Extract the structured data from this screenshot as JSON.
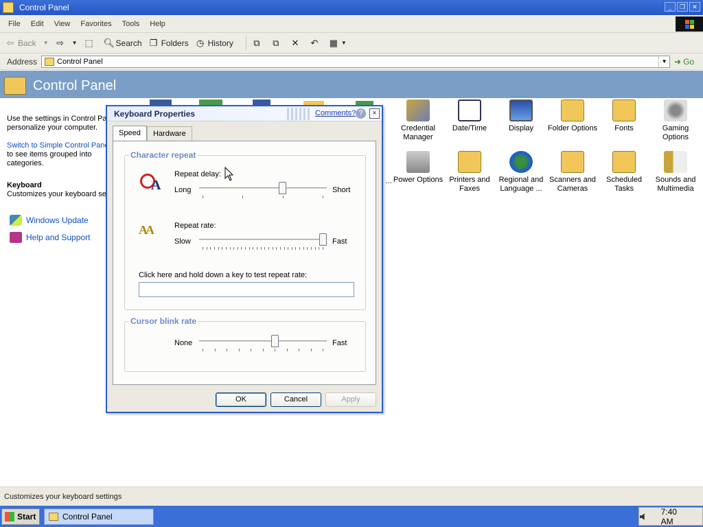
{
  "window": {
    "title": "Control Panel"
  },
  "menu": [
    "File",
    "Edit",
    "View",
    "Favorites",
    "Tools",
    "Help"
  ],
  "toolbar": {
    "back": "Back",
    "search": "Search",
    "folders": "Folders",
    "history": "History"
  },
  "address": {
    "label": "Address",
    "value": "Control Panel",
    "go": "Go"
  },
  "header": {
    "title": "Control Panel"
  },
  "sidebar": {
    "intro": [
      "Use the settings in Control Pan",
      "personalize your computer."
    ],
    "switch_link": "Switch to Simple Control Panel",
    "switch_desc": [
      "to see items grouped into",
      "categories."
    ],
    "selected_title": "Keyboard",
    "selected_desc": "Customizes your keyboard set",
    "links": [
      "Windows Update",
      "Help and Support"
    ]
  },
  "icons": [
    {
      "label": "Credential Manager"
    },
    {
      "label": "Date/Time"
    },
    {
      "label": "Display"
    },
    {
      "label": "Folder Options"
    },
    {
      "label": "Fonts"
    },
    {
      "label": "Gaming Options"
    },
    {
      "label": "Power Options"
    },
    {
      "label": "Printers and Faxes"
    },
    {
      "label": "Regional and Language ..."
    },
    {
      "label": "Scanners and Cameras"
    },
    {
      "label": "Scheduled Tasks"
    },
    {
      "label": "Sounds and Multimedia"
    }
  ],
  "partial_icon_label": "l ...",
  "dialog": {
    "title": "Keyboard Properties",
    "comments": "Comments?",
    "help": "?",
    "close": "×",
    "tabs": [
      "Speed",
      "Hardware"
    ],
    "char_repeat": {
      "title": "Character repeat",
      "delay_label": "Repeat delay:",
      "delay_min": "Long",
      "delay_max": "Short",
      "delay_value": 0.66,
      "rate_label": "Repeat rate:",
      "rate_min": "Slow",
      "rate_max": "Fast",
      "rate_value": 1.0,
      "test_label": "Click here and hold down a key to test repeat rate:"
    },
    "cursor": {
      "title": "Cursor blink rate",
      "min": "None",
      "max": "Fast",
      "value": 0.6
    },
    "buttons": {
      "ok": "OK",
      "cancel": "Cancel",
      "apply": "Apply"
    }
  },
  "status": "Customizes your keyboard settings",
  "taskbar": {
    "start": "Start",
    "task": "Control Panel",
    "clock": "7:40 AM"
  }
}
